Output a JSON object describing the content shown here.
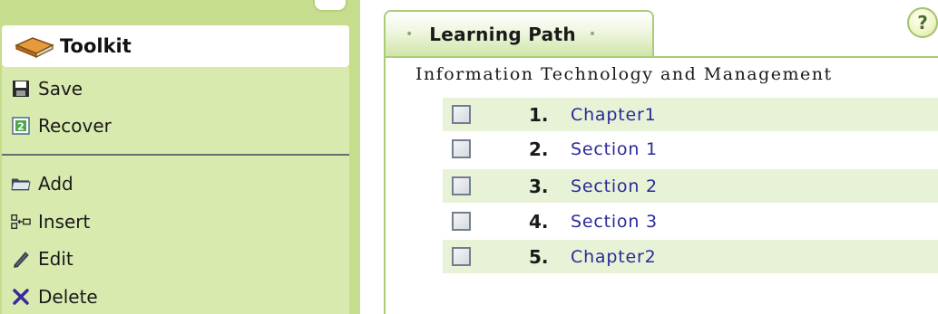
{
  "toolkit": {
    "title": "Toolkit",
    "items": [
      {
        "label": "Save",
        "icon": "floppy-disk-icon"
      },
      {
        "label": "Recover",
        "icon": "recover-icon"
      },
      {
        "label": "Add",
        "icon": "folder-icon"
      },
      {
        "label": "Insert",
        "icon": "insert-icon"
      },
      {
        "label": "Edit",
        "icon": "pencil-icon"
      },
      {
        "label": "Delete",
        "icon": "x-delete-icon"
      }
    ]
  },
  "learning_path": {
    "tab_title": "Learning Path",
    "help_label": "?",
    "course_title": "Information Technology and Management",
    "rows": [
      {
        "number": "1.",
        "label": "Chapter1",
        "checked": false
      },
      {
        "number": "2.",
        "label": "Section 1",
        "checked": false
      },
      {
        "number": "3.",
        "label": "Section 2",
        "checked": false
      },
      {
        "number": "4.",
        "label": "Section 3",
        "checked": false
      },
      {
        "number": "5.",
        "label": "Chapter2",
        "checked": false
      }
    ]
  },
  "colors": {
    "sidebar_bg": "#c5dd8d",
    "sidebar_body": "#d9eaaf",
    "row_alt": "#e8f2d6",
    "link_text": "#2a2a9a",
    "border": "#aacc77"
  }
}
